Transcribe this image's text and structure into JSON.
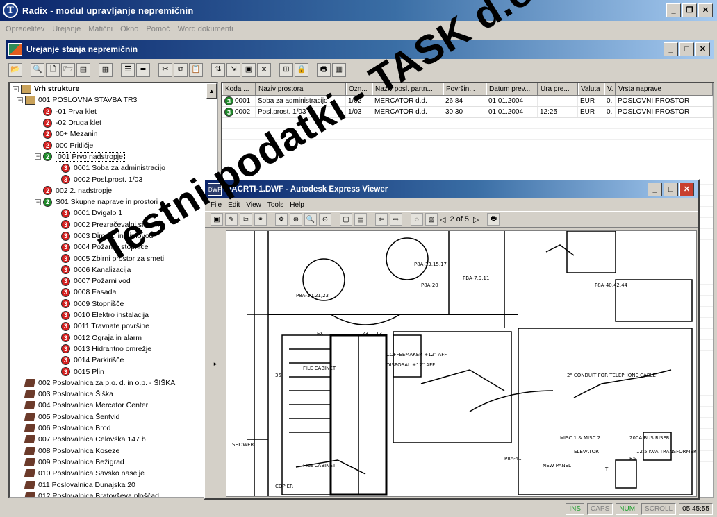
{
  "app": {
    "title": "Radix - modul upravljanje nepremičnin",
    "logo_letter": "T"
  },
  "menu": [
    "Opredelitev",
    "Urejanje",
    "Matični",
    "Okno",
    "Pomoč",
    "Word dokumenti"
  ],
  "child_window": {
    "title": "Urejanje stanja nepremičnin"
  },
  "tree": {
    "root": "Vrh strukture",
    "items": [
      {
        "level": 1,
        "type": "book",
        "badge": "",
        "label": "001  POSLOVNA STAVBA TR3",
        "expander": "−"
      },
      {
        "level": 2,
        "type": "badge",
        "badge": "2",
        "color": "red",
        "label": "-01  Prva klet",
        "expander": ""
      },
      {
        "level": 2,
        "type": "badge",
        "badge": "2",
        "color": "red",
        "label": "-02  Druga klet",
        "expander": ""
      },
      {
        "level": 2,
        "type": "badge",
        "badge": "2",
        "color": "red",
        "label": "00+  Mezanin",
        "expander": ""
      },
      {
        "level": 2,
        "type": "badge",
        "badge": "2",
        "color": "red",
        "label": "000  Pritličje",
        "expander": ""
      },
      {
        "level": 2,
        "type": "badge",
        "badge": "2",
        "color": "green",
        "label": "001  Prvo nadstropje",
        "expander": "−",
        "boxed": true
      },
      {
        "level": 3,
        "type": "badge",
        "badge": "3",
        "color": "red",
        "label": "0001  Soba za administracijo",
        "expander": ""
      },
      {
        "level": 3,
        "type": "badge",
        "badge": "3",
        "color": "red",
        "label": "0002  Posl.prost. 1/03",
        "expander": ""
      },
      {
        "level": 2,
        "type": "badge",
        "badge": "2",
        "color": "red",
        "label": "002  2. nadstropje",
        "expander": ""
      },
      {
        "level": 2,
        "type": "badge",
        "badge": "2",
        "color": "green",
        "label": "S01  Skupne naprave in prostori",
        "expander": "−"
      },
      {
        "level": 3,
        "type": "badge",
        "badge": "3",
        "color": "red",
        "label": "0001  Dvigalo  1",
        "expander": ""
      },
      {
        "level": 3,
        "type": "badge",
        "badge": "3",
        "color": "red",
        "label": "0002  Prezračevalni sistem",
        "expander": ""
      },
      {
        "level": 3,
        "type": "badge",
        "badge": "3",
        "color": "red",
        "label": "0003  Dimniki in dimovodi",
        "expander": ""
      },
      {
        "level": 3,
        "type": "badge",
        "badge": "3",
        "color": "red",
        "label": "0004  Požarne stopnice",
        "expander": ""
      },
      {
        "level": 3,
        "type": "badge",
        "badge": "3",
        "color": "red",
        "label": "0005  Zbirni prostor za smeti",
        "expander": ""
      },
      {
        "level": 3,
        "type": "badge",
        "badge": "3",
        "color": "red",
        "label": "0006  Kanalizacija",
        "expander": ""
      },
      {
        "level": 3,
        "type": "badge",
        "badge": "3",
        "color": "red",
        "label": "0007  Požarni vod",
        "expander": ""
      },
      {
        "level": 3,
        "type": "badge",
        "badge": "3",
        "color": "red",
        "label": "0008  Fasada",
        "expander": ""
      },
      {
        "level": 3,
        "type": "badge",
        "badge": "3",
        "color": "red",
        "label": "0009  Stopnišče",
        "expander": ""
      },
      {
        "level": 3,
        "type": "badge",
        "badge": "3",
        "color": "red",
        "label": "0010  Elektro instalacija",
        "expander": ""
      },
      {
        "level": 3,
        "type": "badge",
        "badge": "3",
        "color": "red",
        "label": "0011  Travnate površine",
        "expander": ""
      },
      {
        "level": 3,
        "type": "badge",
        "badge": "3",
        "color": "red",
        "label": "0012  Ograja in alarm",
        "expander": ""
      },
      {
        "level": 3,
        "type": "badge",
        "badge": "3",
        "color": "red",
        "label": "0013  Hidrantno omrežje",
        "expander": ""
      },
      {
        "level": 3,
        "type": "badge",
        "badge": "3",
        "color": "red",
        "label": "0014  Parkirišče",
        "expander": ""
      },
      {
        "level": 3,
        "type": "badge",
        "badge": "3",
        "color": "red",
        "label": "0015  Plin",
        "expander": ""
      },
      {
        "level": 1,
        "type": "building",
        "badge": "",
        "label": "002  Poslovalnica za p.o. d. in o.p. - ŠIŠKA",
        "expander": ""
      },
      {
        "level": 1,
        "type": "building",
        "badge": "",
        "label": "003  Poslovalnica Šiška",
        "expander": ""
      },
      {
        "level": 1,
        "type": "building",
        "badge": "",
        "label": "004  Poslovalnica Mercator Center",
        "expander": ""
      },
      {
        "level": 1,
        "type": "building",
        "badge": "",
        "label": "005  Poslovalnica Šentvid",
        "expander": ""
      },
      {
        "level": 1,
        "type": "building",
        "badge": "",
        "label": "006  Poslovalnica Brod",
        "expander": ""
      },
      {
        "level": 1,
        "type": "building",
        "badge": "",
        "label": "007  Poslovalnica Celovška 147 b",
        "expander": ""
      },
      {
        "level": 1,
        "type": "building",
        "badge": "",
        "label": "008  Poslovalnica Koseze",
        "expander": ""
      },
      {
        "level": 1,
        "type": "building",
        "badge": "",
        "label": "009  Poslovalnica Bežigrad",
        "expander": ""
      },
      {
        "level": 1,
        "type": "building",
        "badge": "",
        "label": "010  Poslovalnica Savsko naselje",
        "expander": ""
      },
      {
        "level": 1,
        "type": "building",
        "badge": "",
        "label": "011  Poslovalnica Dunajska 20",
        "expander": ""
      },
      {
        "level": 1,
        "type": "building",
        "badge": "",
        "label": "012  Poslovalnica Bratovševa ploščad",
        "expander": ""
      }
    ]
  },
  "grid": {
    "columns": [
      "Koda ...",
      "Naziv prostora",
      "Ozn...",
      "Naziv posl. partn...",
      "Površin...",
      "Datum prev...",
      "Ura pre...",
      "Valuta",
      "V.",
      "Vrsta naprave"
    ],
    "rows": [
      {
        "badge": "3",
        "cells": [
          "0001",
          "Soba za administracijo",
          "1/02",
          "MERCATOR d.d.",
          "26.84",
          "01.01.2004",
          "",
          "EUR",
          "0.",
          "POSLOVNI PROSTOR"
        ]
      },
      {
        "badge": "3",
        "cells": [
          "0002",
          "Posl.prost. 1/03",
          "1/03",
          "MERCATOR d.d.",
          "30.30",
          "01.01.2004",
          "12:25",
          "EUR",
          "0.",
          "POSLOVNI PROSTOR"
        ]
      }
    ]
  },
  "viewer": {
    "title": "NACRTI-1.DWF - Autodesk Express Viewer",
    "menu": [
      "File",
      "Edit",
      "View",
      "Tools",
      "Help"
    ],
    "page_indicator": "2 of 5",
    "drawing_labels": [
      "FILE CABINET",
      "FILE CABINET",
      "COPIER",
      "SHOWER",
      "2\" CONDUIT FOR TELEPHONE CABLE",
      "200A BUS RISER",
      "NEW PANEL",
      "MISC 1 & MISC 2",
      "ELEVATOR",
      "12.5 KVA TRANSFORMER",
      "COFFEEMAKER +12\" AFF",
      "DISPOSAL +12\" AFF",
      "P8A-13,15,17",
      "P8A-10,21,23",
      "PBA-7,9,11",
      "P8A-20",
      "P8A-40,42,44",
      "P8A-41",
      "R5",
      "T",
      "EX",
      "35",
      "23",
      "13"
    ]
  },
  "status": {
    "ins": "INS",
    "caps": "CAPS",
    "num": "NUM",
    "scroll": "SCROLL",
    "time": "05:45:55"
  },
  "watermark": "Testni podatki - TASK d.o.o.",
  "colors": {
    "title_gradient_start": "#0a246a",
    "badge_red": "#d42020",
    "badge_green": "#1f8a2a"
  }
}
